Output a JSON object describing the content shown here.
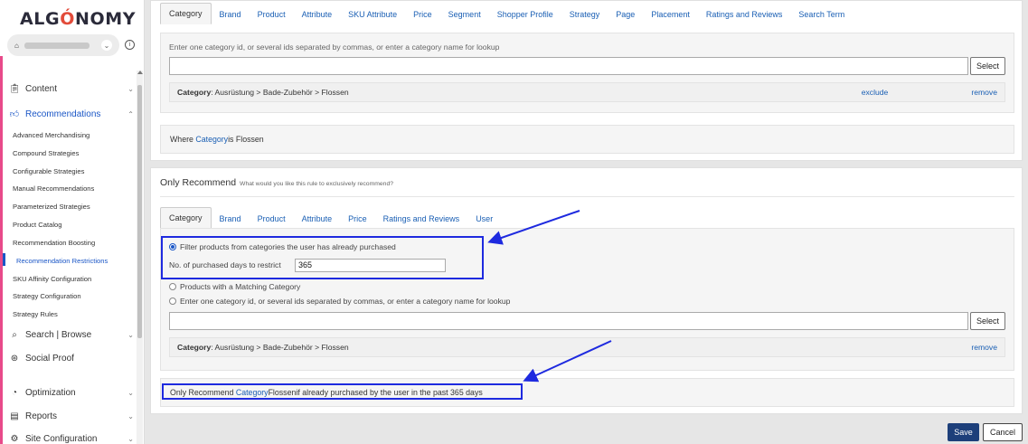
{
  "app": {
    "logo": "ALGONOMY",
    "logo_o": "O"
  },
  "sidebar": {
    "items": [
      {
        "label": "Content",
        "icon": "clipboard-icon",
        "chevron": "⌄"
      },
      {
        "label": "Recommendations",
        "icon": "thumbs-up-icon",
        "chevron": "⌃"
      },
      {
        "label": "Search | Browse",
        "icon": "search-icon",
        "chevron": "⌄"
      },
      {
        "label": "Social Proof",
        "icon": "social-proof-icon",
        "chevron": ""
      },
      {
        "label": "Optimization",
        "icon": "optimization-icon",
        "chevron": "⌄"
      },
      {
        "label": "Reports",
        "icon": "reports-icon",
        "chevron": "⌄"
      },
      {
        "label": "Site Configuration",
        "icon": "site-config-icon",
        "chevron": "⌄"
      }
    ],
    "sub_items": [
      "Advanced Merchandising",
      "Compound Strategies",
      "Configurable Strategies",
      "Manual Recommendations",
      "Parameterized Strategies",
      "Product Catalog",
      "Recommendation Boosting",
      "Recommendation Restrictions",
      "SKU Affinity Configuration",
      "Strategy Configuration",
      "Strategy Rules"
    ]
  },
  "condition": {
    "tabs": [
      "Category",
      "Brand",
      "Product",
      "Attribute",
      "SKU Attribute",
      "Price",
      "Segment",
      "Shopper Profile",
      "Strategy",
      "Page",
      "Placement",
      "Ratings and Reviews",
      "Search Term"
    ],
    "help": "Enter one category id, or several ids separated by commas, or enter a category name for lookup",
    "input_value": "",
    "select_label": "Select",
    "selected": {
      "label": "Category",
      "path": ": Ausrüstung > Bade-Zubehör > Flossen",
      "exclude": "exclude",
      "remove": "remove"
    },
    "summary": {
      "prefix": "Where ",
      "field": "Category",
      "middle": " is ",
      "value": "Flossen"
    }
  },
  "recommend": {
    "title": "Only Recommend",
    "subtitle": "What would you like this rule to exclusively recommend?",
    "tabs": [
      "Category",
      "Brand",
      "Product",
      "Attribute",
      "Price",
      "Ratings and Reviews",
      "User"
    ],
    "option1": "Filter products from categories the user has already purchased",
    "days_label": "No. of purchased days to restrict",
    "days_value": "365",
    "option2": "Products with a Matching Category",
    "option3": "Enter one category id, or several ids separated by commas, or enter a category name for lookup",
    "input_value": "",
    "select_label": "Select",
    "selected": {
      "label": "Category",
      "path": ": Ausrüstung > Bade-Zubehör > Flossen",
      "remove": "remove"
    },
    "summary": {
      "prefix": "Only Recommend ",
      "field": "Category",
      "value": " Flossen",
      "suffix": " if already purchased by the user in the past 365 days"
    }
  },
  "footer": {
    "save": "Save",
    "cancel": "Cancel"
  },
  "colors": {
    "accent": "#1a56c6",
    "annotation": "#1e2adf",
    "brand_bar": "#e84a8a",
    "save_bg": "#1d3f7a"
  }
}
